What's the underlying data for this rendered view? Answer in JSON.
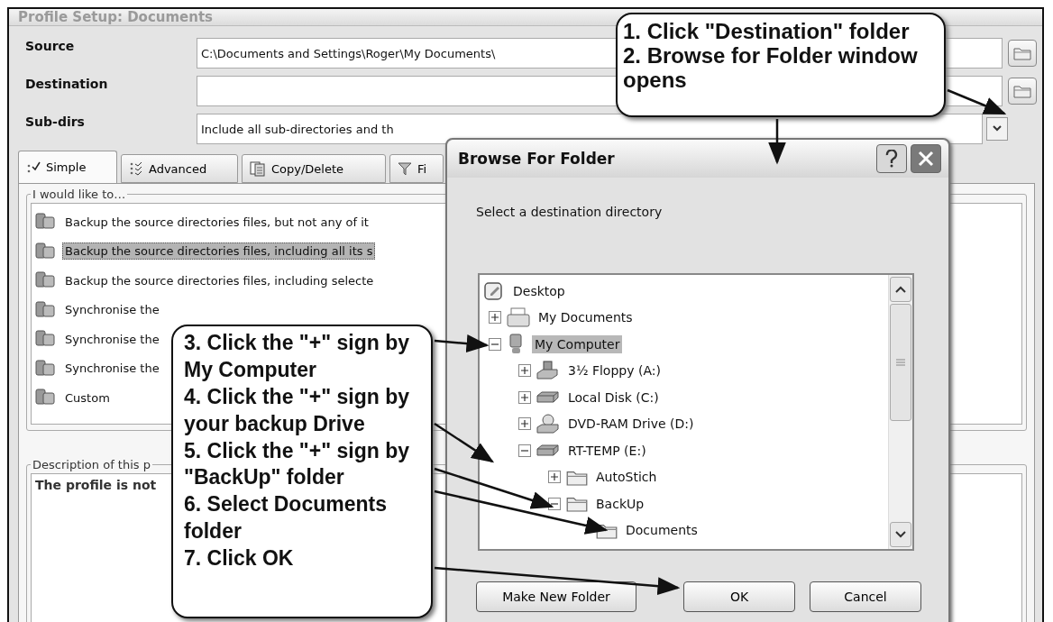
{
  "window": {
    "title": "Profile Setup: Documents"
  },
  "fields": [
    {
      "label": "Source",
      "kind": "text",
      "value": "C:\\Documents and Settings\\Roger\\My Documents\\"
    },
    {
      "label": "Destination",
      "kind": "text"
    },
    {
      "label": "Sub-dirs",
      "kind": "dropdown",
      "value": "Include all sub-directories and th"
    }
  ],
  "tabs": [
    {
      "label": "Simple",
      "selected": true,
      "kind": "check"
    },
    {
      "label": "Advanced",
      "selected": false,
      "kind": "advanced"
    },
    {
      "label": "Copy/Delete",
      "selected": false,
      "kind": "copy"
    },
    {
      "label": "Fi",
      "selected": false,
      "kind": "filter"
    }
  ],
  "options_group": {
    "title": "I would like to…",
    "items": [
      {
        "label": "Backup the source directories files, but not any of it",
        "selected": false
      },
      {
        "label": "Backup the source directories files, including all its s",
        "selected": true
      },
      {
        "label": "Backup the source directories files, including selecte",
        "selected": false
      },
      {
        "label": "Synchronise the",
        "selected": false
      },
      {
        "label": "Synchronise the",
        "selected": false
      },
      {
        "label": "Synchronise the",
        "selected": false
      },
      {
        "label": "Custom",
        "selected": false
      }
    ]
  },
  "description_group": {
    "title": "Description of this p",
    "text": "The profile is not"
  },
  "dialog": {
    "title": "Browse For Folder",
    "prompt": "Select a destination directory",
    "tree": [
      {
        "label": "Desktop",
        "kind": "desktop",
        "selected": false,
        "children": [
          {
            "label": "My Documents",
            "kind": "documents",
            "selected": false,
            "expanded": false
          },
          {
            "label": "My Computer",
            "kind": "computer",
            "selected": true,
            "expanded": true,
            "children": [
              {
                "label": "3½ Floppy (A:)",
                "kind": "floppy",
                "selected": false,
                "expanded": false
              },
              {
                "label": "Local Disk (C:)",
                "kind": "disk",
                "selected": false,
                "expanded": false
              },
              {
                "label": "DVD-RAM Drive (D:)",
                "kind": "dvd",
                "selected": false,
                "expanded": false
              },
              {
                "label": "RT-TEMP (E:)",
                "kind": "disk",
                "selected": false,
                "expanded": true,
                "children": [
                  {
                    "label": "AutoStich",
                    "kind": "folder",
                    "selected": false,
                    "expanded": false
                  },
                  {
                    "label": "BackUp",
                    "kind": "folder",
                    "selected": false,
                    "expanded": true,
                    "children": [
                      {
                        "label": "Documents",
                        "kind": "folder",
                        "selected": false
                      }
                    ]
                  }
                ]
              }
            ]
          }
        ]
      }
    ],
    "buttons": [
      "Make New Folder",
      "OK",
      "Cancel"
    ]
  },
  "callouts": [
    {
      "steps": [
        "1. Click \"Destination\" folder",
        "2. Browse for Folder window opens"
      ]
    },
    {
      "steps": [
        "3. Click the \"+\" sign by My Computer",
        "4. Click the \"+\" sign by your backup Drive",
        "5. Click the \"+\" sign by \"BackUp\" folder",
        "6. Select Documents folder",
        "7. Click OK"
      ]
    }
  ]
}
